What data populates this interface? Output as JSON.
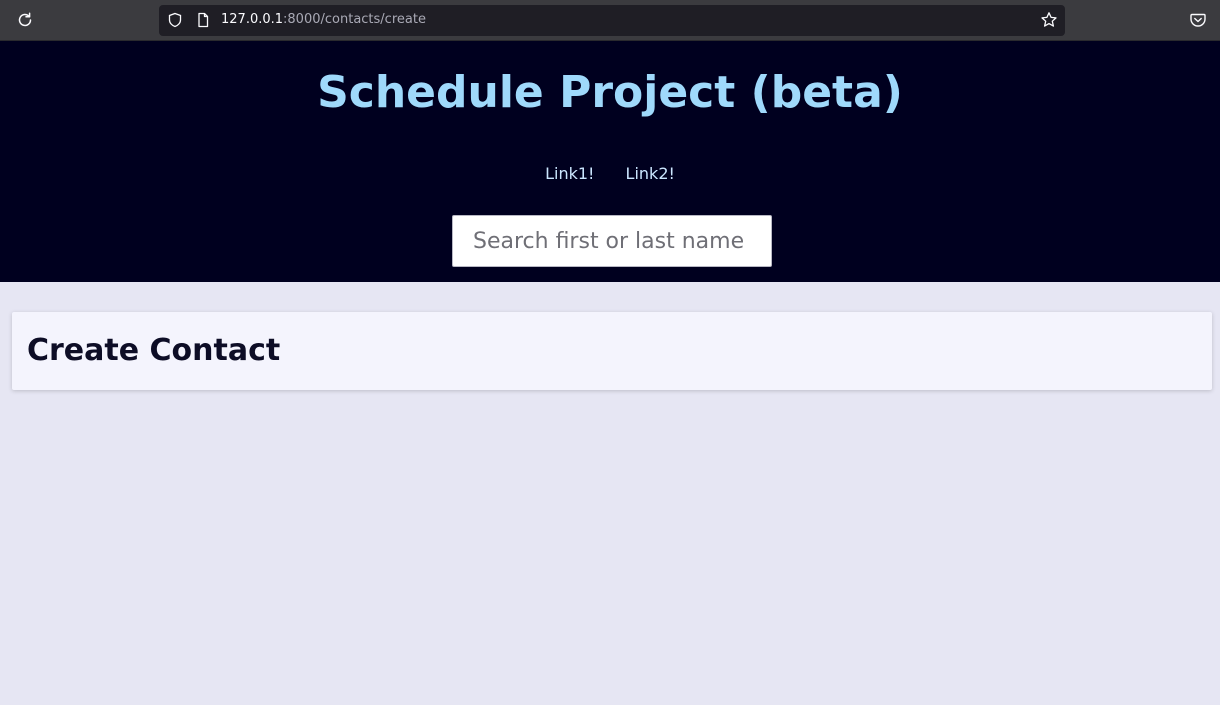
{
  "browser": {
    "url_host": "127.0.0.1",
    "url_path": ":8000/contacts/create",
    "icons": {
      "reload": "reload-icon",
      "shield": "shield-icon",
      "page": "page-icon",
      "bookmark": "star-icon",
      "pocket": "pocket-icon"
    }
  },
  "header": {
    "title": "Schedule Project (beta)",
    "links": [
      {
        "label": "Link1!"
      },
      {
        "label": "Link2!"
      }
    ],
    "search": {
      "placeholder": "Search first or last name",
      "value": ""
    }
  },
  "main": {
    "title": "Create Contact"
  },
  "colors": {
    "header_bg": "#00001f",
    "title": "#9fd9fb",
    "page_bg": "#e6e6f3",
    "card_bg": "#f4f4fd"
  }
}
